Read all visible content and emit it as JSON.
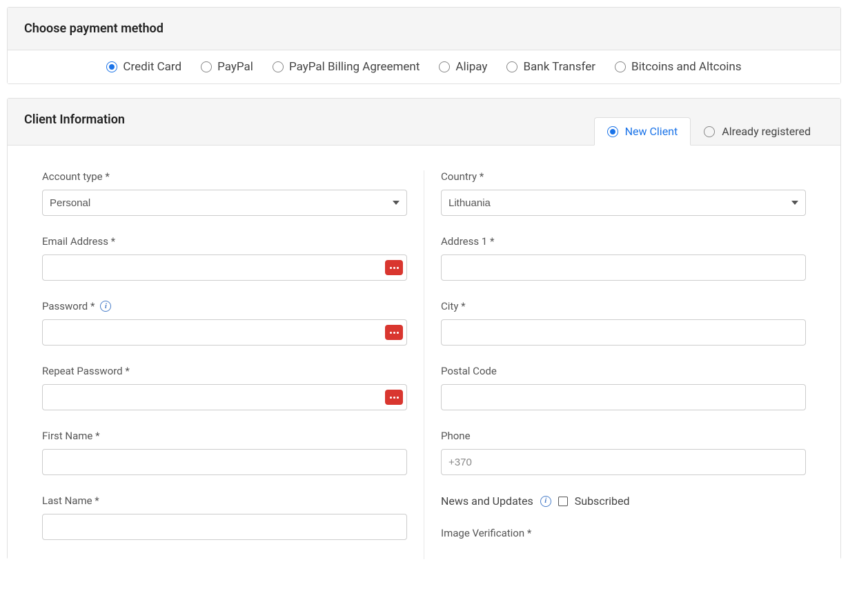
{
  "payment": {
    "title": "Choose payment method",
    "options": [
      {
        "label": "Credit Card",
        "selected": true
      },
      {
        "label": "PayPal",
        "selected": false
      },
      {
        "label": "PayPal Billing Agreement",
        "selected": false
      },
      {
        "label": "Alipay",
        "selected": false
      },
      {
        "label": "Bank Transfer",
        "selected": false
      },
      {
        "label": "Bitcoins and Altcoins",
        "selected": false
      }
    ]
  },
  "client": {
    "title": "Client Information",
    "tabs": {
      "new": "New Client",
      "existing": "Already registered"
    },
    "fields": {
      "account_type": {
        "label": "Account type *",
        "value": "Personal"
      },
      "email": {
        "label": "Email Address *"
      },
      "password": {
        "label": "Password *"
      },
      "repeat_pw": {
        "label": "Repeat Password *"
      },
      "first_name": {
        "label": "First Name *"
      },
      "last_name": {
        "label": "Last Name *"
      },
      "country": {
        "label": "Country *",
        "value": "Lithuania"
      },
      "address1": {
        "label": "Address 1 *"
      },
      "city": {
        "label": "City *"
      },
      "postal": {
        "label": "Postal Code"
      },
      "phone": {
        "label": "Phone",
        "placeholder": "+370"
      },
      "news": {
        "label": "News and Updates",
        "checkbox_label": "Subscribed"
      },
      "image_verif": {
        "label": "Image Verification *"
      }
    }
  }
}
